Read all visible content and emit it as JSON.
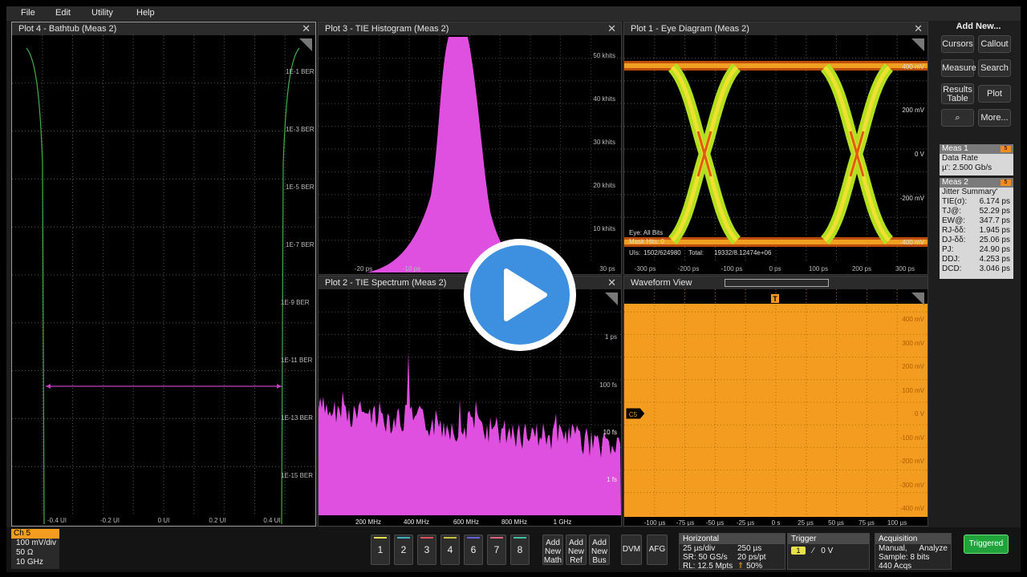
{
  "menu": {
    "file": "File",
    "edit": "Edit",
    "utility": "Utility",
    "help": "Help"
  },
  "plots": {
    "bathtub": {
      "title": "Plot 4 - Bathtub (Meas 2)",
      "y_ticks": [
        "1E-1 BER",
        "1E-3 BER",
        "1E-5 BER",
        "1E-7 BER",
        "1E-9 BER",
        "1E-11 BER",
        "1E-13 BER",
        "1E-15 BER"
      ],
      "x_ticks": [
        "-0.4 UI",
        "-0.2 UI",
        "0 UI",
        "0.2 UI",
        "0.4 UI"
      ],
      "curve_color": "#3fb04a",
      "marker_color": "#c040c0"
    },
    "histogram": {
      "title": "Plot 3 - TIE Histogram (Meas 2)",
      "y_ticks": [
        "50 khits",
        "40 khits",
        "30 khits",
        "20 khits",
        "10 khits"
      ],
      "x_ticks": [
        "-20 ps",
        "-10 ps",
        "30 ps"
      ],
      "fill_color": "#e050e0"
    },
    "eye": {
      "title": "Plot 1 - Eye Diagram (Meas 2)",
      "y_ticks": [
        "400 mV",
        "200 mV",
        "0 V",
        "-200 mV",
        "-400 mV"
      ],
      "x_ticks": [
        "-300 ps",
        "-200 ps",
        "-100 ps",
        "0 ps",
        "100 ps",
        "200 ps",
        "300 ps"
      ],
      "label_eye": "Eye: All Bits",
      "label_mask": "Mask Hits: 0",
      "label_uis": "UIs:",
      "label_uis_value": "1502/624980",
      "label_total": "Total:",
      "label_total_value": "19332/8.12474e+06"
    },
    "spectrum": {
      "title": "Plot 2 - TIE Spectrum (Meas 2)",
      "y_ticks": [
        "1 ps",
        "100 fs",
        "10 fs",
        "1 fs"
      ],
      "x_ticks": [
        "200 MHz",
        "400 MHz",
        "600 MHz",
        "800 MHz",
        "1 GHz"
      ],
      "fill_color": "#e050e0"
    },
    "waveform": {
      "title": "Waveform View",
      "y_ticks": [
        "400 mV",
        "300 mV",
        "200 mV",
        "100 mV",
        "0 V",
        "-100 mV",
        "-200 mV",
        "-300 mV",
        "-400 mV"
      ],
      "x_ticks": [
        "-100 µs",
        "-75 µs",
        "-50 µs",
        "-25 µs",
        "0 s",
        "25 µs",
        "50 µs",
        "75 µs",
        "100 µs"
      ],
      "channel_marker": "C5",
      "trigger_marker": "T",
      "fill_color": "#f39c1f"
    }
  },
  "side_panel": {
    "header": "Add New...",
    "buttons": [
      "Cursors",
      "Callout",
      "Measure",
      "Search",
      "Results Table",
      "Plot",
      "More..."
    ],
    "meas1": {
      "title": "Meas 1",
      "badge": "5",
      "name": "Data Rate",
      "value": "µ': 2.500 Gb/s"
    },
    "meas2": {
      "title": "Meas 2",
      "badge": "5",
      "name": "Jitter Summary'",
      "rows": [
        {
          "label": "TIE(σ):",
          "value": "6.174 ps"
        },
        {
          "label": "TJ@:",
          "value": "52.29 ps"
        },
        {
          "label": "EW@:",
          "value": "347.7 ps"
        },
        {
          "label": "RJ-δδ:",
          "value": "1.945 ps"
        },
        {
          "label": "DJ-δδ:",
          "value": "25.06 ps"
        },
        {
          "label": "PJ:",
          "value": "24.90 ps"
        },
        {
          "label": "DDJ:",
          "value": "4.253 ps"
        },
        {
          "label": "DCD:",
          "value": "3.046 ps"
        }
      ]
    }
  },
  "bottom_bar": {
    "ch5": {
      "title": "Ch 5",
      "scale": "100 mV/div",
      "impedance": "50 Ω",
      "bandwidth": "10 GHz"
    },
    "channels": [
      {
        "label": "1",
        "color": "#e6e04a"
      },
      {
        "label": "2",
        "color": "#3fb0c0"
      },
      {
        "label": "3",
        "color": "#e05060"
      },
      {
        "label": "4",
        "color": "#c8c040"
      },
      {
        "label": "6",
        "color": "#6060e0"
      },
      {
        "label": "7",
        "color": "#e06080"
      },
      {
        "label": "8",
        "color": "#40c0a0"
      }
    ],
    "add_math": "Add New Math",
    "add_ref": "Add New Ref",
    "add_bus": "Add New Bus",
    "dvm": "DVM",
    "afg": "AFG",
    "horizontal": {
      "title": "Horizontal",
      "scale": "25 µs/div",
      "duration": "250 µs",
      "sample_rate": "SR: 50 GS/s",
      "resolution": "20 ps/pt",
      "record_length": "RL: 12.5 Mpts",
      "position": "50%"
    },
    "trigger": {
      "title": "Trigger",
      "source": "1",
      "slope": "⁄",
      "level": "0 V"
    },
    "acquisition": {
      "title": "Acquisition",
      "mode": "Manual,",
      "action": "Analyze",
      "sample": "Sample: 8 bits",
      "acqs": "440 Acqs"
    },
    "status": "Triggered"
  }
}
